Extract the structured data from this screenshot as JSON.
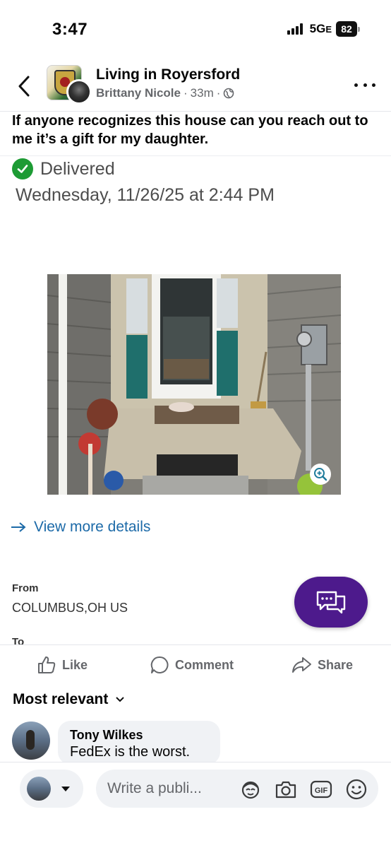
{
  "status_bar": {
    "time": "3:47",
    "network": "5G",
    "network_suffix": "E",
    "battery": "82"
  },
  "post": {
    "group_name": "Living in Royersford",
    "author": "Brittany Nicole",
    "time_ago": "33m",
    "separator": "·",
    "text": "If anyone recognizes this house can you reach out to me it’s a gift for my daughter."
  },
  "screenshot": {
    "status": "Delivered",
    "date": "Wednesday, 11/26/25 at 2:44 PM",
    "view_more": "View more details",
    "from_label": "From",
    "from_value": "COLUMBUS,OH US",
    "to_label": "To",
    "status_color": "#1d9b34",
    "link_color": "#1c6aa8",
    "fab_color": "#4d1a8c"
  },
  "actions": {
    "like": "Like",
    "comment": "Comment",
    "share": "Share"
  },
  "comments": {
    "sort_label": "Most relevant",
    "items": [
      {
        "author": "Tony Wilkes",
        "text": "FedEx is the worst."
      }
    ]
  },
  "composer": {
    "placeholder": "Write a publi..."
  },
  "icons": {
    "back": "chevron-left-icon",
    "more": "more-dots-icon",
    "globe": "globe-icon",
    "check": "check-circle-icon",
    "zoom": "zoom-in-icon",
    "arrow": "arrow-right-icon",
    "chat": "chat-bubbles-icon",
    "like": "thumbs-up-icon",
    "comment": "comment-bubble-icon",
    "share": "share-arrow-icon",
    "sort": "chevron-down-icon",
    "avatar_sticker": "avatar-sticker-icon",
    "camera": "camera-icon",
    "gif": "gif-icon",
    "emoji": "emoji-icon"
  }
}
